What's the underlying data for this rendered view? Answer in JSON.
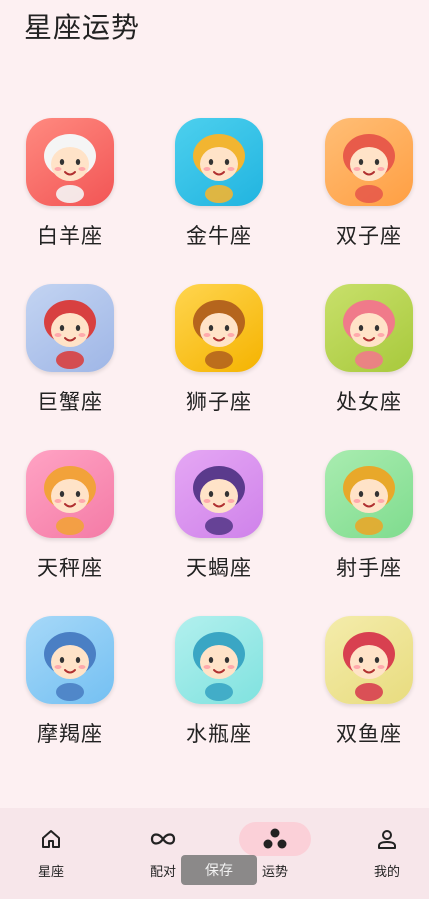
{
  "header": {
    "title": "星座运势"
  },
  "signs": [
    {
      "name": "白羊座",
      "icon": "aries-icon",
      "bg": [
        "#ff8a80",
        "#f25555"
      ]
    },
    {
      "name": "金牛座",
      "icon": "taurus-icon",
      "bg": [
        "#4dd0ee",
        "#21b4e0"
      ]
    },
    {
      "name": "双子座",
      "icon": "gemini-icon",
      "bg": [
        "#ffbe76",
        "#ff9f43"
      ]
    },
    {
      "name": "巨蟹座",
      "icon": "cancer-icon",
      "bg": [
        "#c3d4f2",
        "#9fb6e6"
      ]
    },
    {
      "name": "狮子座",
      "icon": "leo-icon",
      "bg": [
        "#ffd54f",
        "#f5b300"
      ]
    },
    {
      "name": "处女座",
      "icon": "virgo-icon",
      "bg": [
        "#c8e06b",
        "#a8c93c"
      ]
    },
    {
      "name": "天秤座",
      "icon": "libra-icon",
      "bg": [
        "#ffa3c4",
        "#f47ba6"
      ]
    },
    {
      "name": "天蝎座",
      "icon": "scorpio-icon",
      "bg": [
        "#e5a7f4",
        "#cf82ea"
      ]
    },
    {
      "name": "射手座",
      "icon": "sagittarius-icon",
      "bg": [
        "#a9ecb0",
        "#7fdc8e"
      ]
    },
    {
      "name": "摩羯座",
      "icon": "capricorn-icon",
      "bg": [
        "#a6d8f8",
        "#74c0f2"
      ]
    },
    {
      "name": "水瓶座",
      "icon": "aquarius-icon",
      "bg": [
        "#b2f0ee",
        "#80e2df"
      ]
    },
    {
      "name": "双鱼座",
      "icon": "pisces-icon",
      "bg": [
        "#f4ecab",
        "#e8dc7f"
      ]
    }
  ],
  "nav": [
    {
      "label": "星座",
      "icon": "home-icon"
    },
    {
      "label": "配对",
      "icon": "infinity-icon"
    },
    {
      "label": "运势",
      "icon": "three-dots-icon",
      "active": true
    },
    {
      "label": "我的",
      "icon": "person-icon"
    }
  ],
  "toast": {
    "text": "保存"
  },
  "colors": {
    "background": "#fdf0f2",
    "nav_bg": "#f7e6ea",
    "nav_active": "#fbd0d8"
  }
}
